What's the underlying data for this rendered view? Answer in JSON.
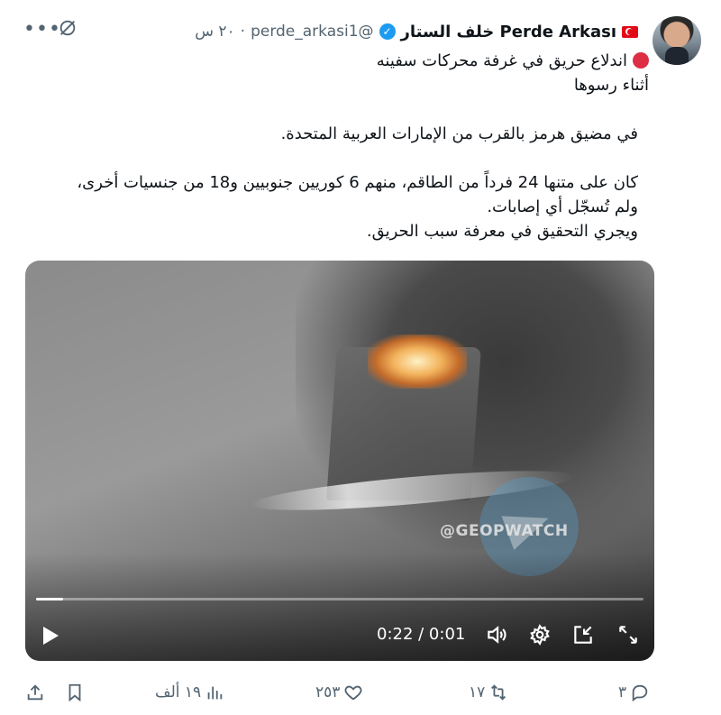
{
  "author": {
    "name": "Perde Arkası خلف الستار",
    "handle": "@perde_arkasi1",
    "time": "٢٠ س"
  },
  "tweet": {
    "line1": "اندلاع حريق في غرفة محركات سفينه",
    "line2": "أثناء رسوها",
    "line3": "في مضيق هرمز بالقرب من الإمارات العربية المتحدة.",
    "line4": "كان على متنها 24 فرداً من الطاقم، منهم 6 كوريين جنوبيين و18 من جنسيات أخرى،",
    "line5": "ولم تُسجّل أي إصابات.",
    "line6": "ويجري التحقيق في معرفة سبب الحريق."
  },
  "video": {
    "watermark": "@GEOPWATCH",
    "timecode": "0:22 / 0:01",
    "progress_fraction": 0.045
  },
  "actions": {
    "replies": "٣",
    "reposts": "١٧",
    "likes": "٢٥٣",
    "views": "١٩ ألف"
  },
  "colors": {
    "accent": "#1d9bf0",
    "muted": "#536471",
    "live_dot": "#dd2e44"
  }
}
